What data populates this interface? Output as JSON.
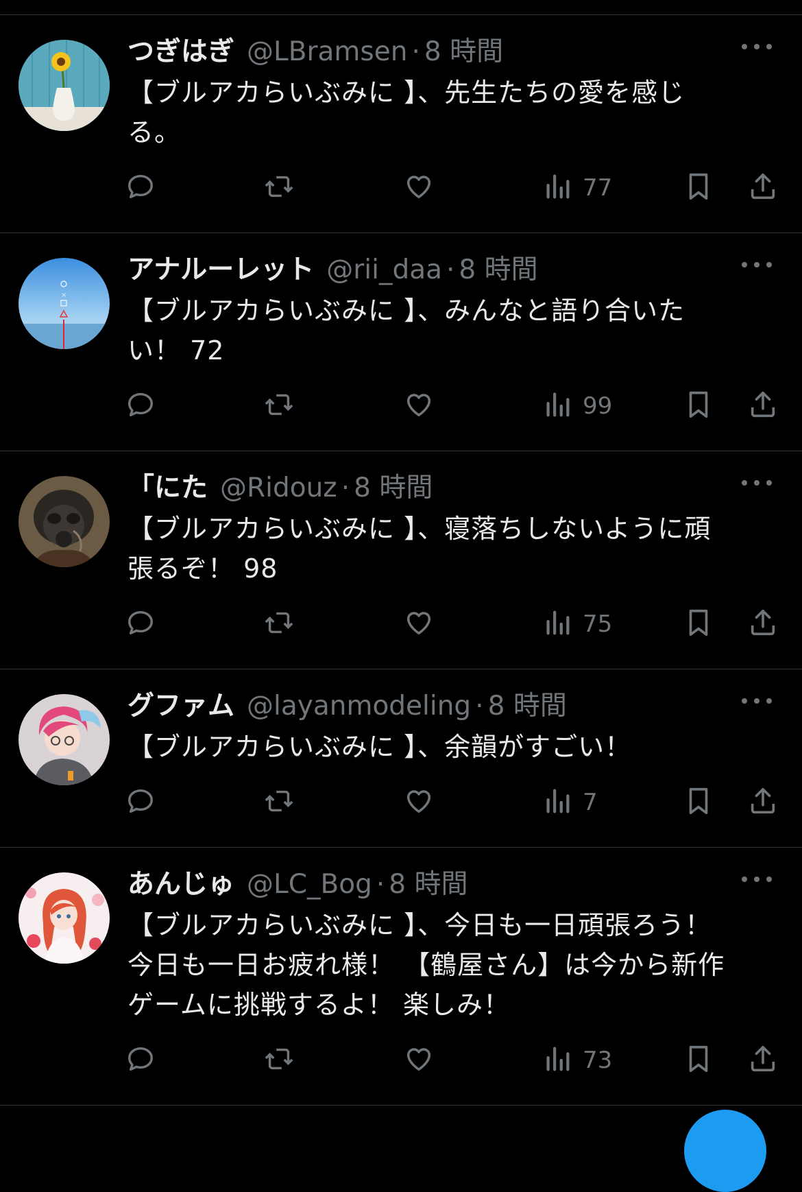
{
  "tweets": [
    {
      "name": "つぎはぎ",
      "handle": "@LBramsen",
      "sep": "·",
      "time": "8 時間",
      "text": "【ブルアカらいぶみに 】、先生たちの愛を感じ\nる。",
      "views": "77",
      "avatar": "sunflower-vase"
    },
    {
      "name": "アナルーレット",
      "handle": "@rii_daa",
      "sep": "·",
      "time": "8 時間",
      "text": "【ブルアカらいぶみに 】、みんなと語り合いた\nい！ 72",
      "views": "99",
      "avatar": "sky-sea"
    },
    {
      "name": "「にた",
      "handle": "@Ridouz",
      "sep": "·",
      "time": "8 時間",
      "text": "【ブルアカらいぶみに 】、寝落ちしないように頑\n張るぞ！ 98",
      "views": "75",
      "avatar": "gasmask-soldier"
    },
    {
      "name": "グファム",
      "handle": "@layanmodeling",
      "sep": "·",
      "time": "8 時間",
      "text": "【ブルアカらいぶみに 】、余韻がすごい！",
      "views": "7",
      "avatar": "anime-pink-hair"
    },
    {
      "name": "あんじゅ",
      "handle": "@LC_Bog",
      "sep": "·",
      "time": "8 時間",
      "text": "【ブルアカらいぶみに 】、今日も一日頑張ろう！\n今日も一日お疲れ様！ 【鶴屋さん】は今から新作\nゲームに挑戦するよ！ 楽しみ！",
      "views": "73",
      "avatar": "anime-red-hair-flowers"
    }
  ],
  "icons": {
    "reply": "reply-icon",
    "retweet": "retweet-icon",
    "like": "like-icon",
    "views": "views-icon",
    "bookmark": "bookmark-icon",
    "share": "share-icon",
    "more": "more-options-icon"
  },
  "colors": {
    "background": "#000000",
    "text": "#e7e9ea",
    "muted": "#71767b",
    "divider": "#2f3336",
    "accent": "#1d9bf0"
  }
}
